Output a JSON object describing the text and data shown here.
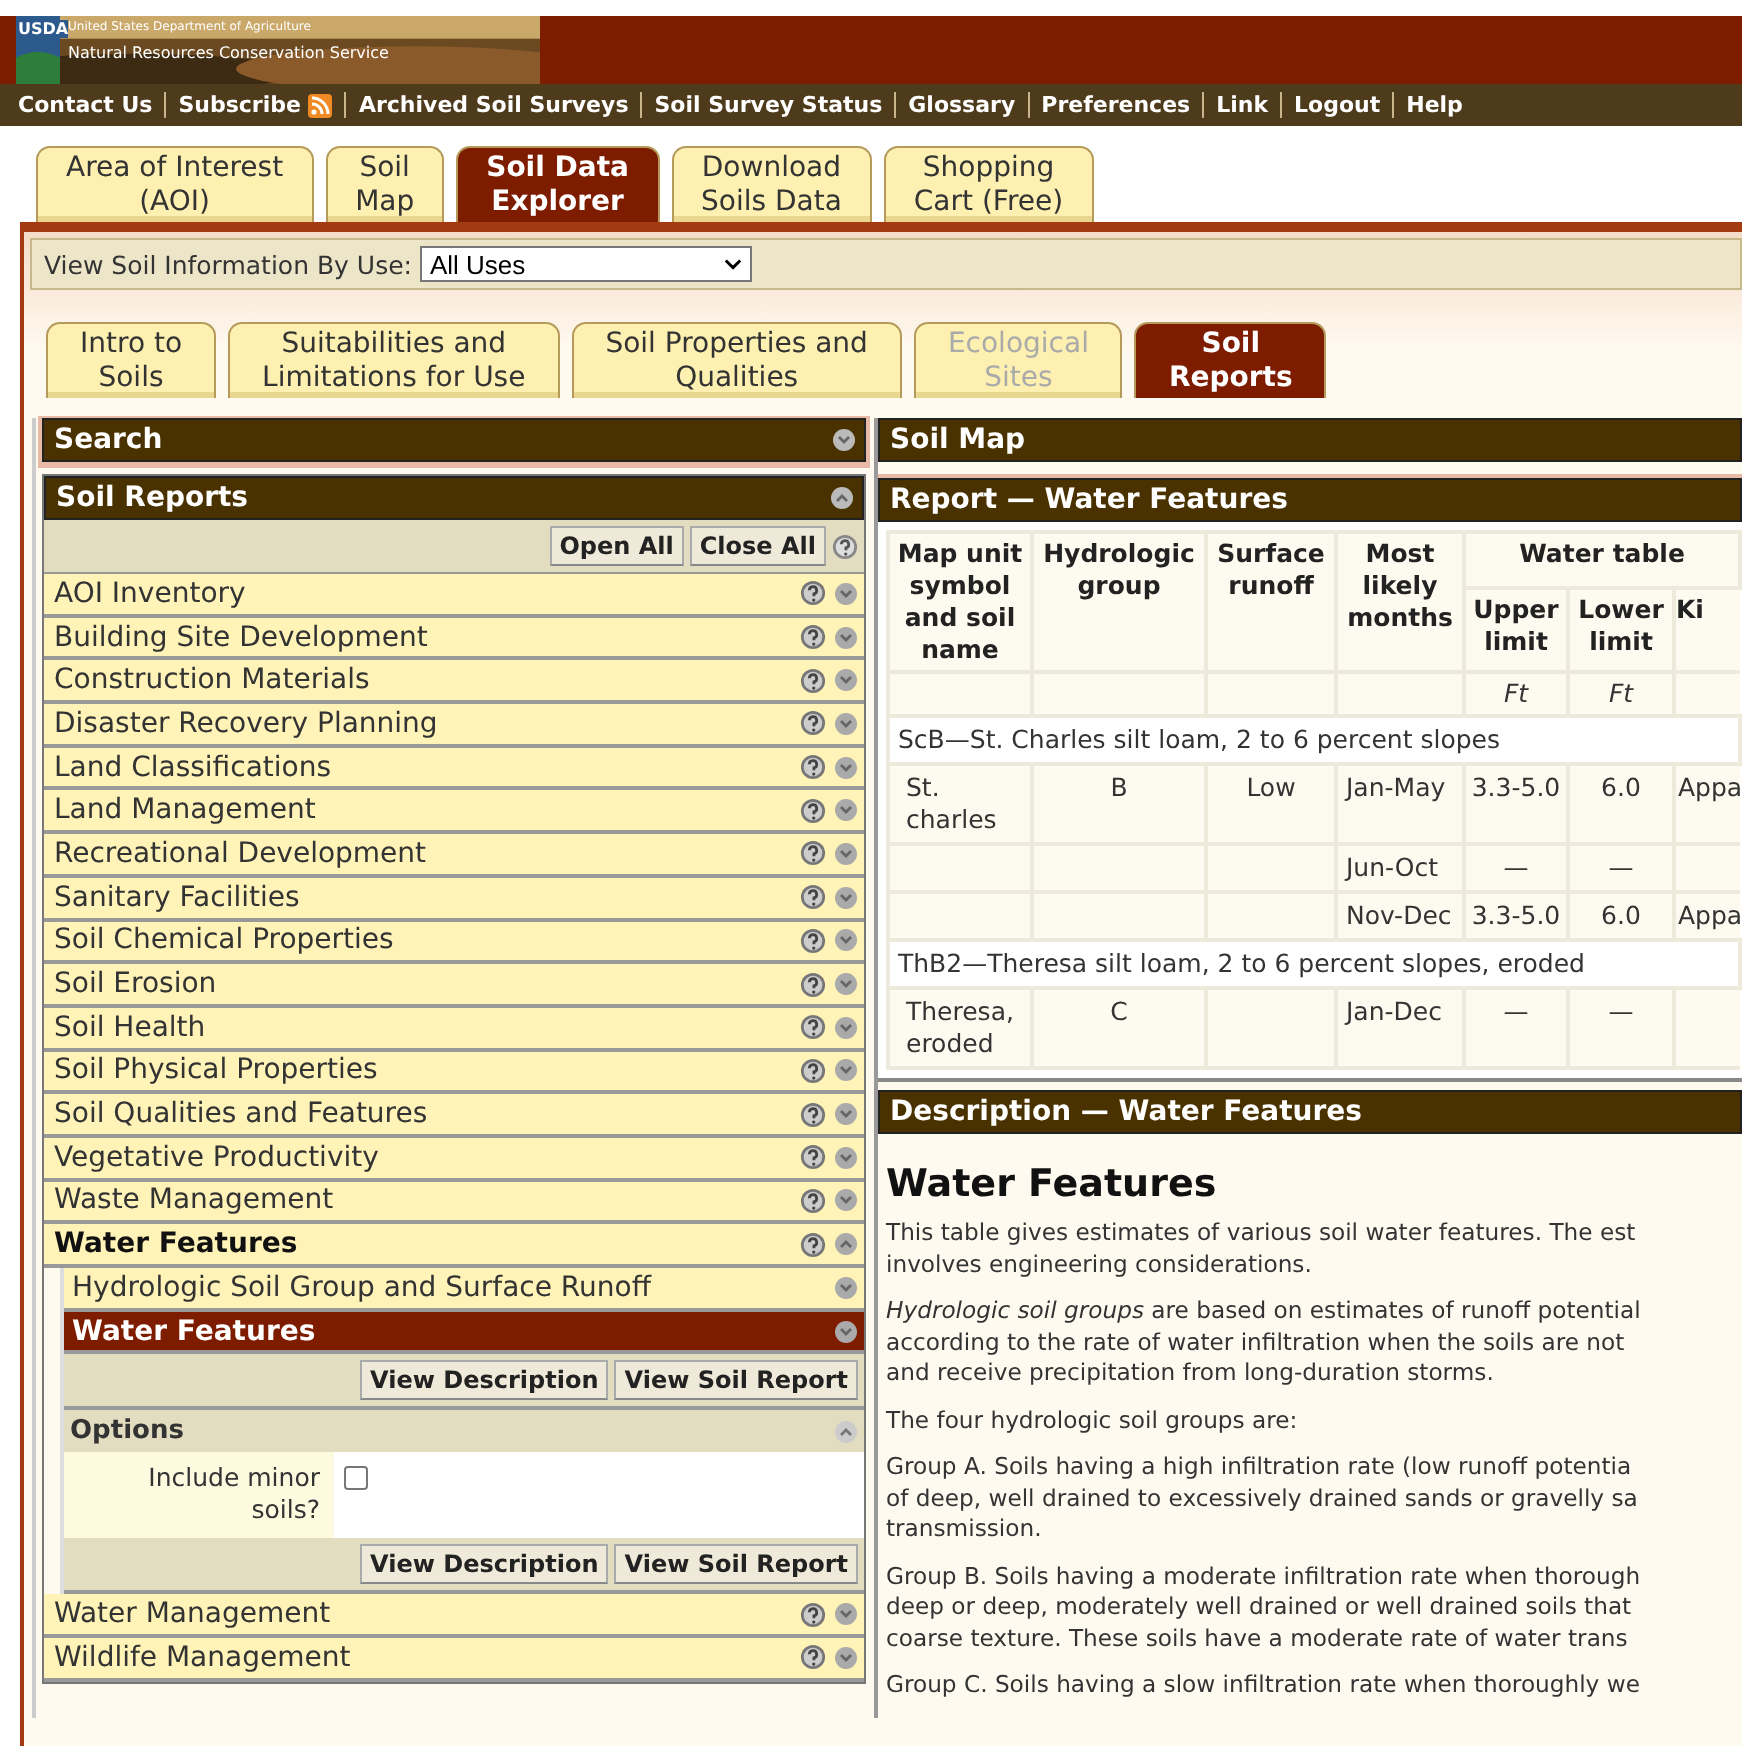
{
  "header": {
    "agency": "USDA",
    "department": "United States Department of Agriculture",
    "service": "Natural Resources Conservation Service"
  },
  "nav_links": [
    {
      "label": "Contact Us",
      "kind": "link"
    },
    {
      "label": "Subscribe",
      "kind": "feed"
    },
    {
      "label": "Archived Soil Surveys",
      "kind": "link"
    },
    {
      "label": "Soil Survey Status",
      "kind": "link"
    },
    {
      "label": "Glossary",
      "kind": "link"
    },
    {
      "label": "Preferences",
      "kind": "link"
    },
    {
      "label": "Link",
      "kind": "link"
    },
    {
      "label": "Logout",
      "kind": "link"
    },
    {
      "label": "Help",
      "kind": "link"
    }
  ],
  "main_tabs": [
    {
      "lines": [
        "Area of Interest",
        "(AOI)"
      ],
      "selected": false
    },
    {
      "lines": [
        "Soil",
        "Map"
      ],
      "selected": false
    },
    {
      "lines": [
        "Soil Data",
        "Explorer"
      ],
      "selected": true
    },
    {
      "lines": [
        "Download",
        "Soils Data"
      ],
      "selected": false
    },
    {
      "lines": [
        "Shopping",
        "Cart (Free)"
      ],
      "selected": false
    }
  ],
  "view_by": {
    "label": "View Soil Information By Use:",
    "value": "All Uses"
  },
  "sub_tabs": [
    {
      "lines": [
        "Intro to",
        "Soils"
      ],
      "selected": false,
      "disabled": false
    },
    {
      "lines": [
        "Suitabilities and",
        "Limitations for Use"
      ],
      "selected": false,
      "disabled": false
    },
    {
      "lines": [
        "Soil Properties and",
        "Qualities"
      ],
      "selected": false,
      "disabled": false
    },
    {
      "lines": [
        "Ecological",
        "Sites"
      ],
      "selected": false,
      "disabled": true
    },
    {
      "lines": [
        "Soil",
        "Reports"
      ],
      "selected": true,
      "disabled": false
    }
  ],
  "search_panel": {
    "title": "Search",
    "expanded": false
  },
  "soil_reports": {
    "title": "Soil Reports",
    "expanded": true,
    "buttons": [
      "Open All",
      "Close All"
    ],
    "items": [
      {
        "label": "AOI Inventory",
        "expanded": false
      },
      {
        "label": "Building Site Development",
        "expanded": false
      },
      {
        "label": "Construction Materials",
        "expanded": false
      },
      {
        "label": "Disaster Recovery Planning",
        "expanded": false
      },
      {
        "label": "Land Classifications",
        "expanded": false
      },
      {
        "label": "Land Management",
        "expanded": false
      },
      {
        "label": "Recreational Development",
        "expanded": false
      },
      {
        "label": "Sanitary Facilities",
        "expanded": false
      },
      {
        "label": "Soil Chemical Properties",
        "expanded": false
      },
      {
        "label": "Soil Erosion",
        "expanded": false
      },
      {
        "label": "Soil Health",
        "expanded": false
      },
      {
        "label": "Soil Physical Properties",
        "expanded": false
      },
      {
        "label": "Soil Qualities and Features",
        "expanded": false
      },
      {
        "label": "Vegetative Productivity",
        "expanded": false
      },
      {
        "label": "Waste Management",
        "expanded": false
      },
      {
        "label": "Water Features",
        "expanded": true,
        "children": [
          {
            "label": "Hydrologic Soil Group and Surface Runoff",
            "selected": false
          },
          {
            "label": "Water Features",
            "selected": true,
            "buttons": [
              "View Description",
              "View Soil Report"
            ],
            "options": {
              "title": "Options",
              "expanded": true,
              "checkbox_label": "Include minor soils?",
              "checked": false
            },
            "bottom_buttons": [
              "View Description",
              "View Soil Report"
            ]
          }
        ]
      },
      {
        "label": "Water Management",
        "expanded": false
      },
      {
        "label": "Wildlife Management",
        "expanded": false
      }
    ]
  },
  "soil_map_panel": {
    "title": "Soil Map"
  },
  "report": {
    "title": "Report — Water Features",
    "columns": [
      "Map unit symbol and soil name",
      "Hydrologic group",
      "Surface runoff",
      "Most likely months"
    ],
    "group_header": "Water table",
    "sub_columns": [
      {
        "label": "Upper limit",
        "unit": "Ft"
      },
      {
        "label": "Lower limit",
        "unit": "Ft"
      },
      {
        "label": "Ki"
      }
    ],
    "rows": [
      {
        "kind": "map_unit",
        "text": "ScB—St. Charles silt loam, 2 to 6 percent slopes"
      },
      {
        "kind": "data",
        "cells": [
          "St. charles",
          "B",
          "Low",
          "Jan-May",
          "3.3-5.0",
          "6.0",
          "Appa"
        ]
      },
      {
        "kind": "data",
        "cells": [
          null,
          null,
          null,
          "Jun-Oct",
          "—",
          "—",
          null
        ]
      },
      {
        "kind": "data",
        "cells": [
          null,
          null,
          null,
          "Nov-Dec",
          "3.3-5.0",
          "6.0",
          "Appa"
        ]
      },
      {
        "kind": "map_unit",
        "text": "ThB2—Theresa silt loam, 2 to 6 percent slopes, eroded"
      },
      {
        "kind": "data",
        "cells": [
          "Theresa, eroded",
          "C",
          null,
          "Jan-Dec",
          "—",
          "—",
          null
        ]
      }
    ]
  },
  "description": {
    "title": "Description — Water Features",
    "heading": "Water Features",
    "paragraphs": [
      [
        "This table gives estimates of various soil water features. The est",
        "involves engineering considerations."
      ],
      [
        "*Hydrologic soil groups* are based on estimates of runoff potential",
        "according to the rate of water infiltration when the soils are not",
        "and receive precipitation from long-duration storms."
      ],
      [
        "The four hydrologic soil groups are:"
      ],
      [
        "Group A. Soils having a high infiltration rate (low runoff potentia",
        "of deep, well drained to excessively drained sands or gravelly sa",
        "transmission."
      ],
      [
        "Group B. Soils having a moderate infiltration rate when thorough",
        "deep or deep, moderately well drained or well drained soils that",
        "coarse texture. These soils have a moderate rate of water trans"
      ],
      [
        "Group C. Soils having a slow infiltration rate when thoroughly we"
      ]
    ]
  }
}
